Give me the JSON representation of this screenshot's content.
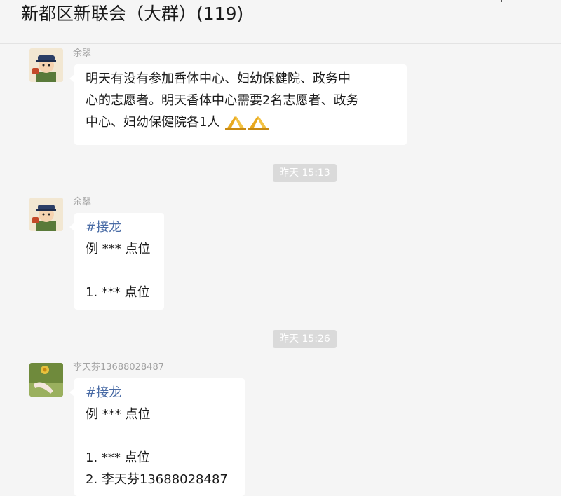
{
  "header": {
    "title": "新都区新联会（大群）(119)"
  },
  "messages": [
    {
      "sender": "余翠",
      "lines": [
        "明天有没有参加香体中心、妇幼保健院、政务中",
        "心的志愿者。明天香体中心需要2名志愿者、政务",
        "中心、妇幼保健院各1人"
      ],
      "emoji": [
        "praying-hands-icon",
        "praying-hands-icon"
      ]
    },
    {
      "timestamp": "昨天 15:13"
    },
    {
      "sender": "余翠",
      "tag": "#接龙",
      "lines": [
        "例 *** 点位",
        "",
        "1. *** 点位"
      ]
    },
    {
      "timestamp": "昨天 15:26"
    },
    {
      "sender": "李天芬13688028487",
      "tag": "#接龙",
      "lines": [
        "例 *** 点位",
        "",
        "1. *** 点位",
        "2. 李天芬13688028487"
      ]
    }
  ]
}
